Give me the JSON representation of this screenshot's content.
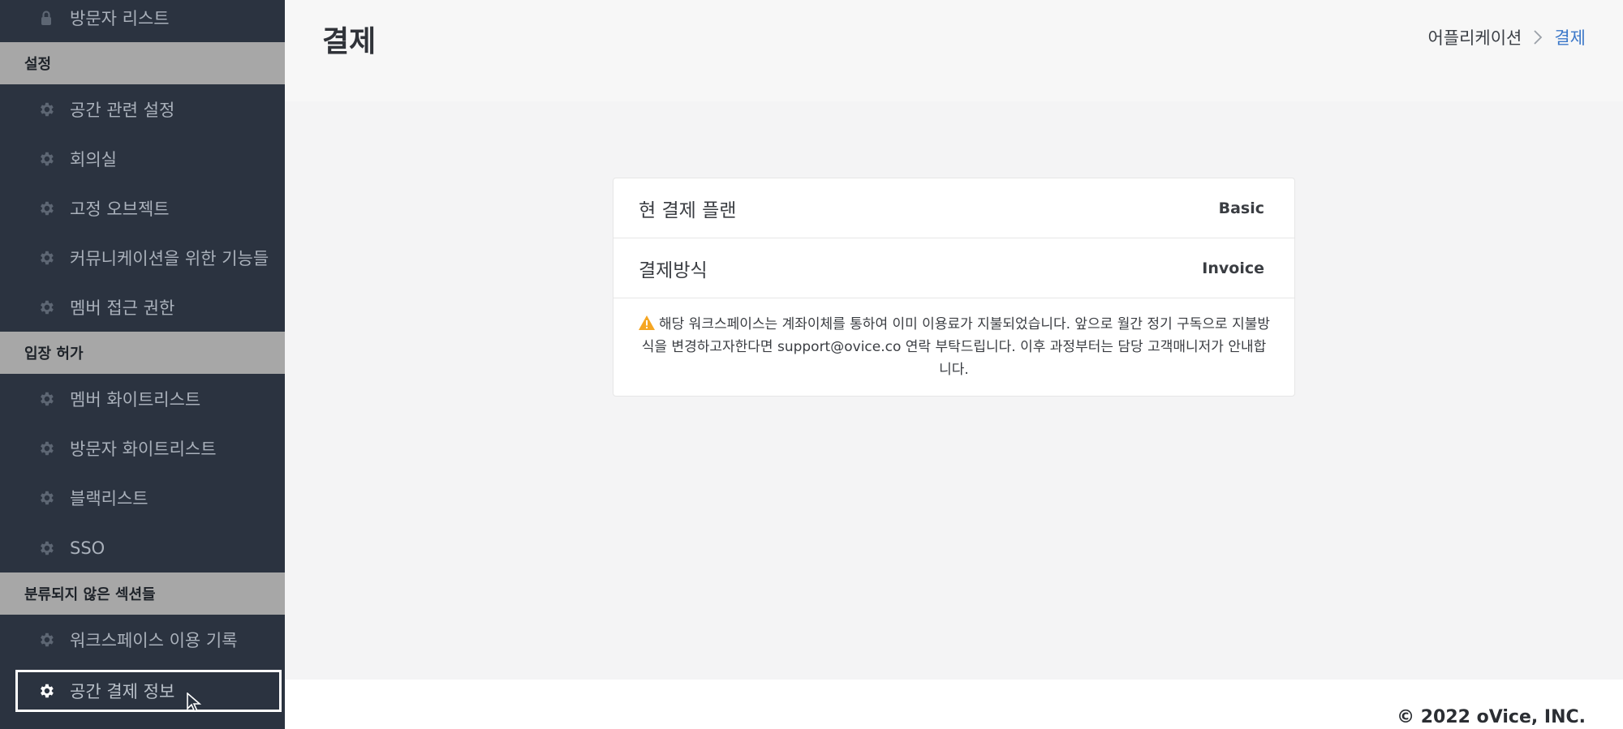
{
  "sidebar": {
    "items": [
      {
        "label": "방문자 리스트",
        "icon": "lock-icon"
      },
      {
        "label": "공간 관련 설정",
        "icon": "gear-icon"
      },
      {
        "label": "회의실",
        "icon": "gear-icon"
      },
      {
        "label": "고정 오브젝트",
        "icon": "gear-icon"
      },
      {
        "label": "커뮤니케이션을 위한 기능들",
        "icon": "gear-icon"
      },
      {
        "label": "멤버 접근 권한",
        "icon": "gear-icon"
      },
      {
        "label": "멤버 화이트리스트",
        "icon": "gear-icon"
      },
      {
        "label": "방문자 화이트리스트",
        "icon": "gear-icon"
      },
      {
        "label": "블랙리스트",
        "icon": "gear-icon"
      },
      {
        "label": "SSO",
        "icon": "gear-icon"
      },
      {
        "label": "워크스페이스 이용 기록",
        "icon": "gear-icon"
      },
      {
        "label": "공간 결제 정보",
        "icon": "gear-icon",
        "active": true
      }
    ],
    "sections": [
      "설정",
      "입장 허가",
      "분류되지 않은 섹션들"
    ]
  },
  "header": {
    "title": "결제",
    "breadcrumb": {
      "parent": "어플리케이션",
      "current": "결제"
    }
  },
  "billing": {
    "plan_label": "현 결제 플랜",
    "plan_value": "Basic",
    "method_label": "결제방식",
    "method_value": "Invoice",
    "notice": "해당 워크스페이스는 계좌이체를 통하여 이미 이용료가 지불되었습니다. 앞으로 월간 정기 구독으로 지불방식을 변경하고자한다면 support@ovice.co 연락 부탁드립니다. 이후 과정부터는 담당 고객매니저가 안내합니다."
  },
  "footer": {
    "copyright": "© 2022 oVice, INC."
  },
  "colors": {
    "sidebar_bg": "#2b3340",
    "section_bg": "#a7a7a7",
    "accent": "#3c78c9",
    "warning": "#f5a623"
  }
}
